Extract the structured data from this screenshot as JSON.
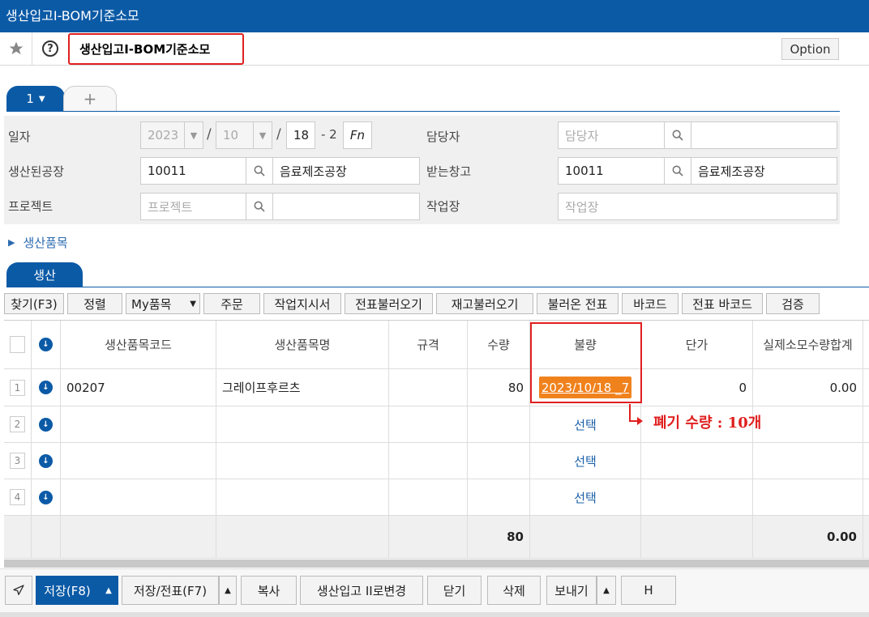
{
  "window": {
    "title": "생산입고I-BOM기준소모"
  },
  "topbar": {
    "page_title": "생산입고I-BOM기준소모",
    "option_label": "Option"
  },
  "tabs": {
    "active_label": "1",
    "add_label": "+"
  },
  "form": {
    "date_label": "일자",
    "date_year": "2023",
    "date_month": "10",
    "date_day": "18",
    "date_sep": "/",
    "date_seq": "- 2",
    "fn_label": "Fn",
    "manager_label": "담당자",
    "manager_placeholder": "담당자",
    "factory_label": "생산된공장",
    "factory_code": "10011",
    "factory_name": "음료제조공장",
    "warehouse_label": "받는창고",
    "warehouse_code": "10011",
    "warehouse_name": "음료제조공장",
    "project_label": "프로젝트",
    "project_placeholder": "프로젝트",
    "workplace_label": "작업장",
    "workplace_placeholder": "작업장"
  },
  "section": {
    "label": "생산품목"
  },
  "grid_tab": {
    "label": "생산"
  },
  "toolbar": {
    "find": "찾기(F3)",
    "sort": "정렬",
    "my_items": "My품목",
    "order": "주문",
    "work_order": "작업지시서",
    "load_slip": "전표불러오기",
    "load_stock": "재고불러오기",
    "loaded_slip": "불러온 전표",
    "barcode": "바코드",
    "slip_barcode": "전표 바코드",
    "verify": "검증"
  },
  "grid": {
    "headers": {
      "code": "생산품목코드",
      "name": "생산품목명",
      "spec": "규격",
      "qty": "수량",
      "defect": "불량",
      "price": "단가",
      "actual": "실제소모수량합계"
    },
    "rows": [
      {
        "num": "1",
        "code": "00207",
        "name": "그레이프후르츠",
        "spec": "",
        "qty": "80",
        "defect": "2023/10/18 _7",
        "price": "0",
        "actual": "0.00"
      },
      {
        "num": "2",
        "code": "",
        "name": "",
        "spec": "",
        "qty": "",
        "defect": "선택",
        "price": "",
        "actual": ""
      },
      {
        "num": "3",
        "code": "",
        "name": "",
        "spec": "",
        "qty": "",
        "defect": "선택",
        "price": "",
        "actual": ""
      },
      {
        "num": "4",
        "code": "",
        "name": "",
        "spec": "",
        "qty": "",
        "defect": "선택",
        "price": "",
        "actual": ""
      }
    ],
    "totals": {
      "qty": "80",
      "actual": "0.00"
    }
  },
  "annotation": {
    "text": "폐기 수량 : 10개",
    "color": "#e02020"
  },
  "bottom": {
    "save": "저장(F8)",
    "save_slip": "저장/전표(F7)",
    "copy": "복사",
    "change_to_2": "생산입고 II로변경",
    "close": "닫기",
    "delete": "삭제",
    "send": "보내기",
    "h": "H"
  },
  "colors": {
    "accent": "#0b5aa6",
    "highlight": "#f0821e",
    "annotation": "#e02020"
  }
}
